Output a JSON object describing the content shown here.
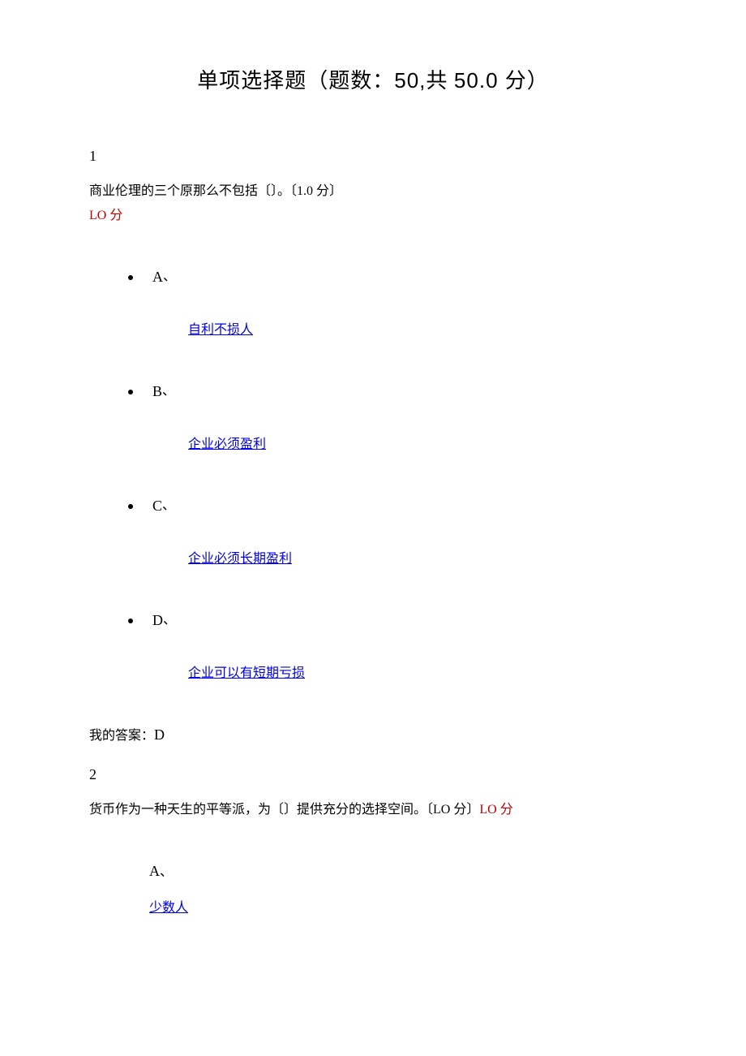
{
  "title": {
    "prefix": "单项选择题（题数：",
    "count": "50,",
    "mid": "共 ",
    "total": "50.0 ",
    "suffix": "分）"
  },
  "q1": {
    "num": "1",
    "text_pre": "商业伦理的三个原那么不包括〔〕。〔",
    "point": "1.0 ",
    "text_post": "分〕",
    "lo": "LO",
    "lo_cn": " 分",
    "options": [
      {
        "letter": "A",
        "punct": "、",
        "answer": "自利不损人"
      },
      {
        "letter": "B",
        "punct": "、",
        "answer": "企业必须盈利"
      },
      {
        "letter": "C",
        "punct": "、",
        "answer": "企业必须长期盈利"
      },
      {
        "letter": "D",
        "punct": "、",
        "answer": "企业可以有短期亏损"
      }
    ],
    "my_answer_label": "我的答案：",
    "my_answer_value": "D"
  },
  "q2": {
    "num": "2",
    "text_pre": "货币作为一种天生的平等派，为〔〕提供充分的选择空间。〔",
    "lo1": "LO",
    "mid_cn": " 分〕",
    "lo2": "LO",
    "lo2_cn": " 分",
    "options": [
      {
        "letter": "A",
        "punct": "、",
        "answer": "少数人"
      }
    ]
  }
}
